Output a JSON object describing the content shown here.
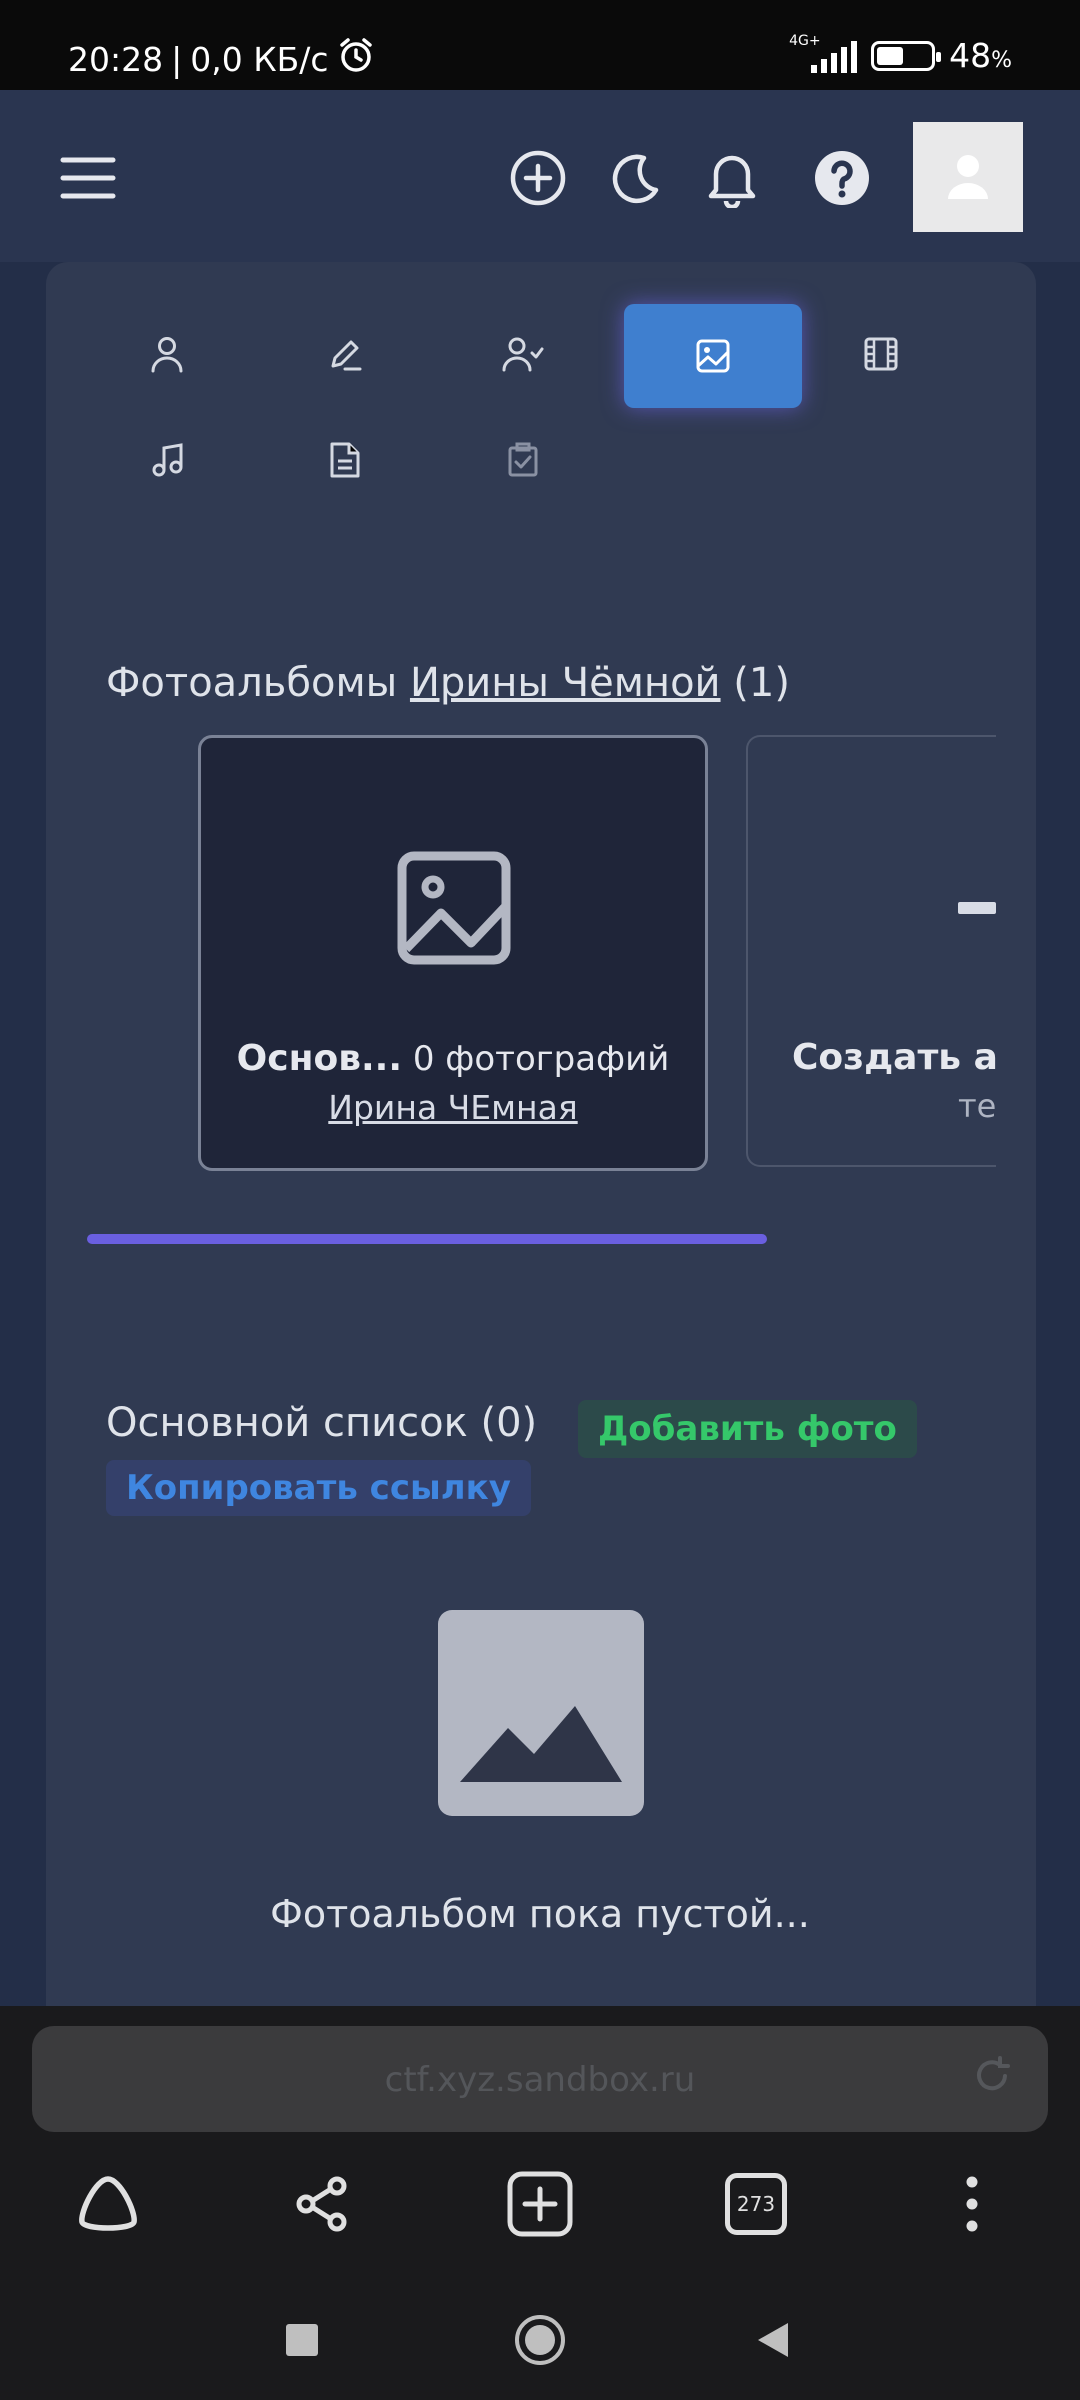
{
  "status_bar": {
    "time": "20:28",
    "speed": "0,0 КБ/с",
    "network": "4G+",
    "battery_percent": "48",
    "battery_level": 0.48
  },
  "header": {
    "icons": [
      "menu-icon",
      "plus-circle-icon",
      "moon-icon",
      "bell-icon",
      "help-icon",
      "user-avatar-icon"
    ]
  },
  "tabs": {
    "items": [
      "user-icon",
      "pencil-icon",
      "user-check-icon",
      "image-icon",
      "film-icon",
      "music-icon",
      "document-icon",
      "checkbox-icon"
    ],
    "active": "image-icon"
  },
  "albums": {
    "title_prefix": "Фотоальбомы",
    "owner_link": "Ирины Чёмной",
    "count": "(1)",
    "cards": [
      {
        "name": "Основ...",
        "photos": "0 фотографий",
        "owner": "Ирина ЧЕмная"
      }
    ],
    "create_title": "Создать а",
    "create_sub": "те"
  },
  "list": {
    "title": "Основной список (0)",
    "add_photo": "Добавить фото",
    "copy_link": "Копировать ссылку",
    "empty_text": "Фотоальбом пока пустой..."
  },
  "browser": {
    "url": "ctf.xyz.sandbox.ru",
    "tabs_count": "273"
  },
  "colors": {
    "header_bg": "#2a3550",
    "card_bg": "#303a52",
    "active_tab": "#3f7fcf",
    "add_photo": "#35c86a",
    "copy_link": "#3f86e0",
    "progress": "#6a5fe0"
  }
}
